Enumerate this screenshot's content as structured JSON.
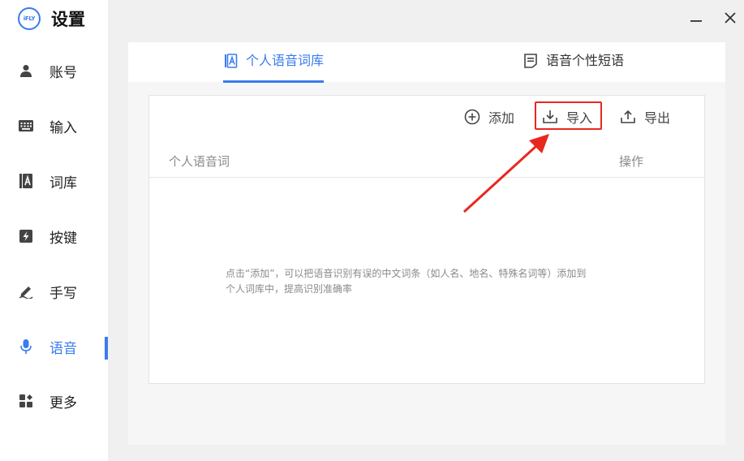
{
  "app": {
    "logo_text": "iFLY",
    "title": "设置"
  },
  "window_controls": {
    "minimize_icon": "minimize-icon",
    "close_icon": "close-icon"
  },
  "sidebar": {
    "items": [
      {
        "label": "账号",
        "icon": "user-icon"
      },
      {
        "label": "输入",
        "icon": "keyboard-icon"
      },
      {
        "label": "词库",
        "icon": "lexicon-icon"
      },
      {
        "label": "按键",
        "icon": "lightning-key-icon"
      },
      {
        "label": "手写",
        "icon": "pen-icon"
      },
      {
        "label": "语音",
        "icon": "microphone-icon",
        "active": true
      },
      {
        "label": "更多",
        "icon": "grid-more-icon"
      }
    ]
  },
  "tabs": [
    {
      "label": "个人语音词库",
      "icon": "lexicon-icon",
      "active": true
    },
    {
      "label": "语音个性短语",
      "icon": "note-icon"
    }
  ],
  "toolbar": {
    "add_label": "添加",
    "import_label": "导入",
    "export_label": "导出"
  },
  "table": {
    "headers": [
      "个人语音词",
      "操作"
    ],
    "empty_message_line1": "点击“添加”，可以把语音识别有误的中文词条（如人名、地名、特殊名词等）添加到",
    "empty_message_line2": "个人词库中，提高识别准确率"
  },
  "colors": {
    "accent": "#3a7bf0",
    "annotation_red": "#e8281e"
  }
}
